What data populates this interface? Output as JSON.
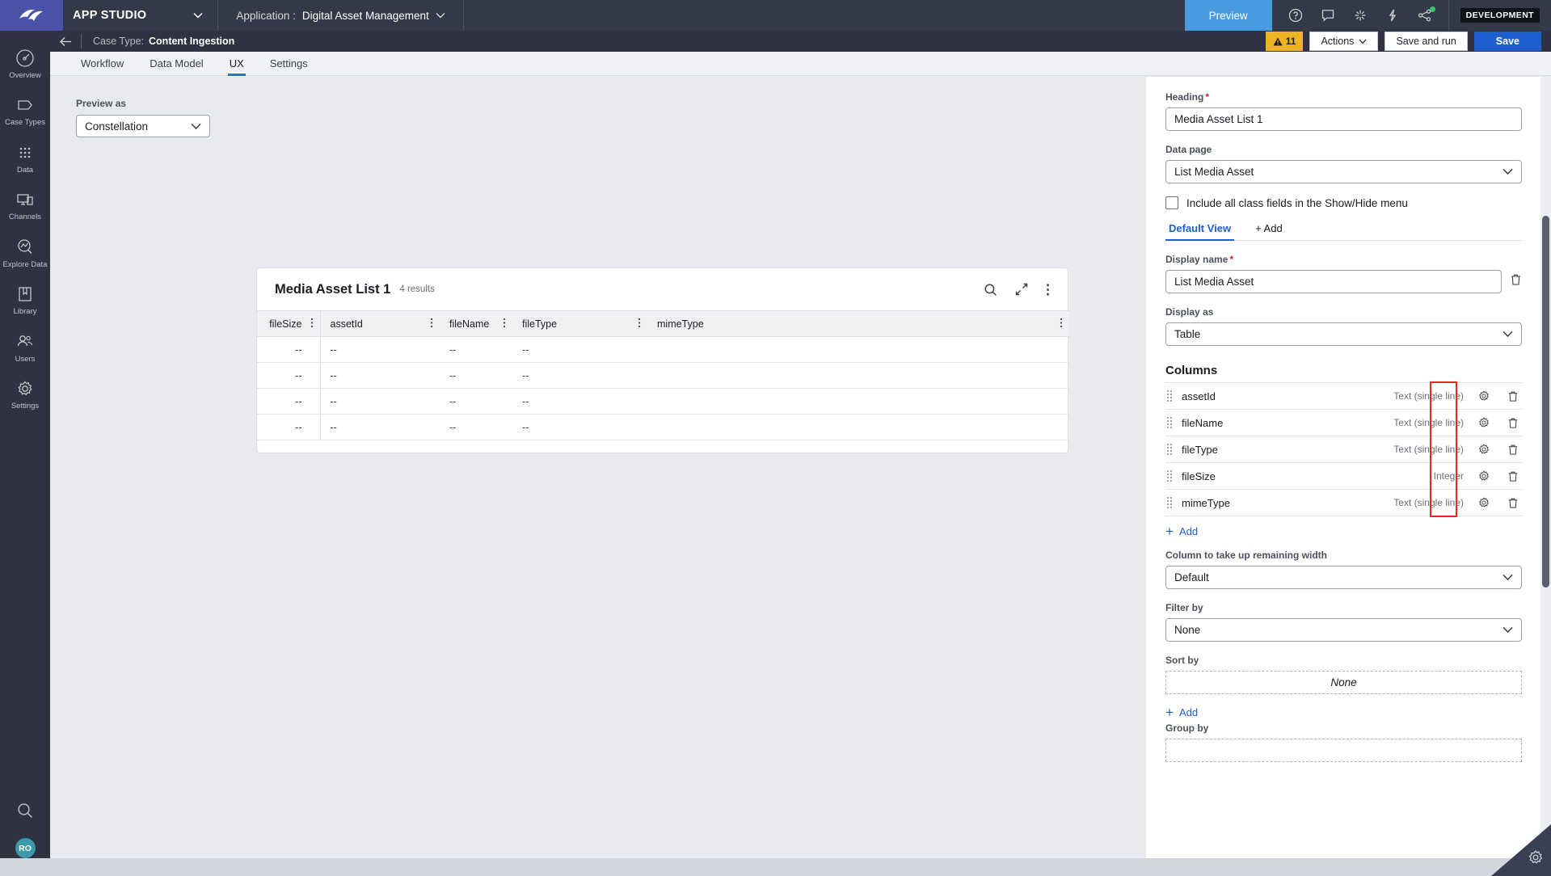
{
  "topbar": {
    "logo_icon": "pega-logo-icon",
    "app_studio_label": "APP STUDIO",
    "app_studio_chevron": "chevron-down-icon",
    "application_label": "Application :",
    "application_name": "Digital Asset Management",
    "application_chevron": "chevron-down-icon",
    "preview_label": "Preview",
    "icons": [
      "help-icon",
      "feedback-icon",
      "sparkle-icon",
      "bolt-icon",
      "share-icon"
    ],
    "status_dot_color": "#3fbf6e",
    "environment_badge": "DEVELOPMENT"
  },
  "subbar": {
    "back_icon": "back-arrow-icon",
    "case_type_label": "Case Type:",
    "case_type_name": "Content Ingestion",
    "warning_icon": "warning-triangle-icon",
    "warning_count": "11",
    "actions_label": "Actions",
    "actions_chevron": "chevron-down-icon",
    "save_and_run_label": "Save and run",
    "save_label": "Save"
  },
  "sidebar": {
    "items": [
      {
        "label": "Overview",
        "icon": "gauge-icon"
      },
      {
        "label": "Case Types",
        "icon": "case-types-icon"
      },
      {
        "label": "Data",
        "icon": "data-grid-icon"
      },
      {
        "label": "Channels",
        "icon": "channels-icon"
      },
      {
        "label": "Explore Data",
        "icon": "explore-data-icon"
      },
      {
        "label": "Library",
        "icon": "library-icon"
      },
      {
        "label": "Users",
        "icon": "users-icon"
      },
      {
        "label": "Settings",
        "icon": "gear-icon"
      }
    ],
    "search_icon": "search-icon",
    "avatar_initials": "RO",
    "avatar_color": "#3a9aa8"
  },
  "tabs": [
    {
      "label": "Workflow",
      "active": false
    },
    {
      "label": "Data Model",
      "active": false
    },
    {
      "label": "UX",
      "active": true
    },
    {
      "label": "Settings",
      "active": false
    }
  ],
  "canvas": {
    "preview_as_label": "Preview as",
    "preview_as_value": "Constellation",
    "preview_as_chevron": "chevron-down-icon"
  },
  "preview_card": {
    "title": "Media Asset List 1",
    "results_count": "4 results",
    "search_icon": "search-icon",
    "expand_icon": "expand-icon",
    "more_icon": "kebab-menu-icon",
    "columns": [
      {
        "label": "fileSize",
        "align": "right"
      },
      {
        "label": "assetId",
        "align": "left"
      },
      {
        "label": "fileName",
        "align": "left"
      },
      {
        "label": "fileType",
        "align": "left"
      },
      {
        "label": "mimeType",
        "align": "left"
      }
    ],
    "rows": [
      [
        "--",
        "--",
        "--",
        "--",
        ""
      ],
      [
        "--",
        "--",
        "--",
        "--",
        ""
      ],
      [
        "--",
        "--",
        "--",
        "--",
        ""
      ],
      [
        "--",
        "--",
        "--",
        "--",
        ""
      ]
    ]
  },
  "panel": {
    "heading_label": "Heading",
    "heading_value": "Media Asset List 1",
    "data_page_label": "Data page",
    "data_page_value": "List Media Asset",
    "include_all_label": "Include all class fields in the Show/Hide menu",
    "include_all_checked": false,
    "view_tabs": [
      {
        "label": "Default View",
        "active": true
      },
      {
        "label": "+ Add",
        "active": false
      }
    ],
    "display_name_label": "Display name",
    "display_name_value": "List Media Asset",
    "display_name_delete_icon": "trash-icon",
    "display_as_label": "Display as",
    "display_as_value": "Table",
    "columns_heading": "Columns",
    "columns": [
      {
        "name": "assetId",
        "type": "Text (single line)",
        "grip": "drag-handle-icon",
        "gear": "gear-icon",
        "trash": "trash-icon"
      },
      {
        "name": "fileName",
        "type": "Text (single line)",
        "grip": "drag-handle-icon",
        "gear": "gear-icon",
        "trash": "trash-icon"
      },
      {
        "name": "fileType",
        "type": "Text (single line)",
        "grip": "drag-handle-icon",
        "gear": "gear-icon",
        "trash": "trash-icon"
      },
      {
        "name": "fileSize",
        "type": "Integer",
        "grip": "drag-handle-icon",
        "gear": "gear-icon",
        "trash": "trash-icon"
      },
      {
        "name": "mimeType",
        "type": "Text (single line)",
        "grip": "drag-handle-icon",
        "gear": "gear-icon",
        "trash": "trash-icon"
      }
    ],
    "columns_add_label": "Add",
    "remaining_width_label": "Column to take up remaining width",
    "remaining_width_value": "Default",
    "filter_by_label": "Filter by",
    "filter_by_value": "None",
    "sort_by_label": "Sort by",
    "sort_by_value": "None",
    "sort_add_label": "Add",
    "group_by_label": "Group by",
    "highlight_color": "#ef2620",
    "corner_gear_icon": "gear-icon"
  }
}
